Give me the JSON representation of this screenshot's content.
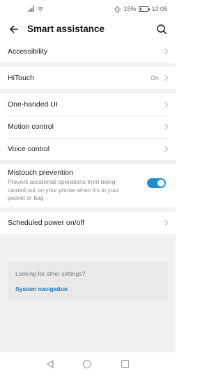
{
  "status_bar": {
    "battery_percent_text": "15%",
    "time": "12:05",
    "battery_level": 0.15
  },
  "header": {
    "title": "Smart assistance",
    "back_icon": "arrow-left-icon",
    "search_icon": "search-icon"
  },
  "items": {
    "accessibility": {
      "label": "Accessibility"
    },
    "hitouch": {
      "label": "HiTouch",
      "value": "On"
    },
    "one_handed": {
      "label": "One-handed UI"
    },
    "motion": {
      "label": "Motion control"
    },
    "voice": {
      "label": "Voice control"
    },
    "mistouch": {
      "label": "Mistouch prevention",
      "description": "Prevent accidental operations from being carried out on your phone when it's in your pocket or bag",
      "enabled": true
    },
    "scheduled_power": {
      "label": "Scheduled power on/off"
    }
  },
  "other_settings": {
    "question": "Looking for other settings?",
    "link": "System navigation"
  },
  "colors": {
    "accent": "#1f8ecf",
    "link": "#1a7bb5",
    "background": "#f1f1f1"
  }
}
